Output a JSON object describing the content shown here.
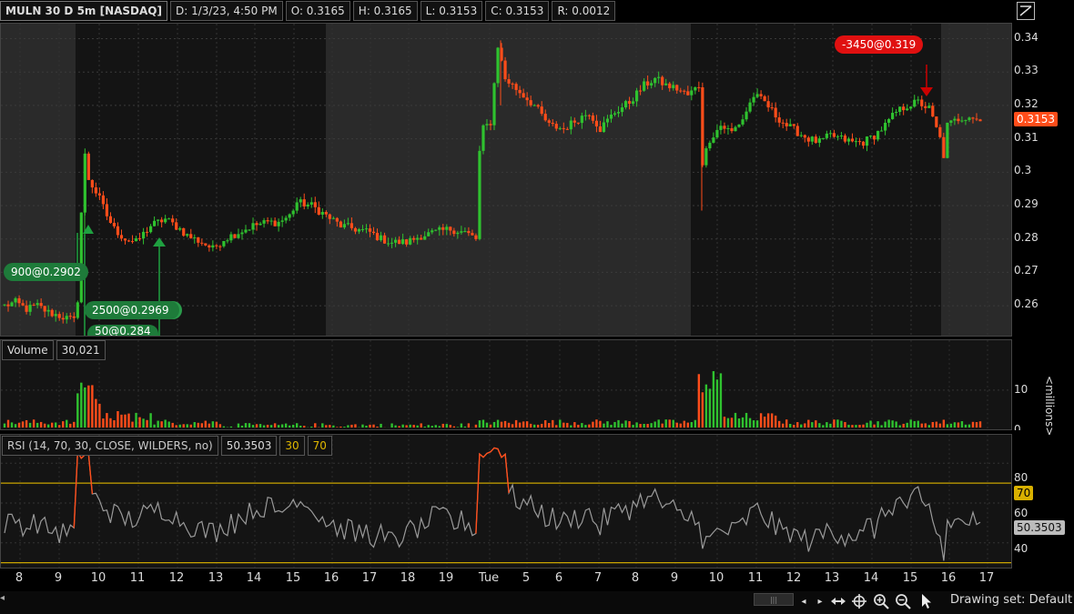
{
  "header": {
    "symbol": "MULN 30 D 5m [NASDAQ]",
    "date": "D: 1/3/23, 4:50 PM",
    "open": "O: 0.3165",
    "high": "H: 0.3165",
    "low": "L: 0.3153",
    "close": "C: 0.3153",
    "range": "R: 0.0012"
  },
  "price_axis": {
    "labels": [
      "0.34",
      "0.33",
      "0.32",
      "0.31",
      "0.3",
      "0.29",
      "0.28",
      "0.27",
      "0.26"
    ],
    "last_price": "0.3153"
  },
  "trades": {
    "sell": "-3450@0.319",
    "buy1": "900@0.2902",
    "buy2": "2500@0.2969",
    "buy3": "50@0.284"
  },
  "volume": {
    "label": "Volume",
    "value": "30,021",
    "axis_labels": [
      "10",
      "0"
    ],
    "unit": "<millions>"
  },
  "rsi": {
    "label": "RSI (14, 70, 30, CLOSE, WILDERS, no)",
    "value": "50.3503",
    "ob": "30",
    "os": "70",
    "axis_labels": [
      "80",
      "60",
      "40"
    ],
    "tag70": "70",
    "tagval": "50.3503"
  },
  "time_axis": {
    "labels": [
      "8",
      "9",
      "10",
      "11",
      "12",
      "13",
      "14",
      "15",
      "16",
      "17",
      "18",
      "19",
      "Tue",
      "5",
      "6",
      "7",
      "8",
      "9",
      "10",
      "11",
      "12",
      "13",
      "14",
      "15",
      "16",
      "17"
    ]
  },
  "footer": {
    "drawing_set": "Drawing set: Default"
  },
  "colors": {
    "up": "#2fc22f",
    "down": "#ff4d1a",
    "rsi_line": "#9a9a9a",
    "rsi_hot": "#ff4d1a",
    "band": "#c9a400",
    "sell_tag": "#e01010",
    "buy_tag": "#1e7b3a"
  },
  "chart_data": {
    "type": "candlestick",
    "price_range": [
      0.2505,
      0.3445
    ],
    "price_path": [
      [
        0,
        0.26
      ],
      [
        3,
        0.261
      ],
      [
        6,
        0.259
      ],
      [
        9,
        0.26
      ],
      [
        12,
        0.258
      ],
      [
        15,
        0.257
      ],
      [
        19,
        0.2555
      ],
      [
        20,
        0.262
      ],
      [
        21,
        0.288
      ],
      [
        22,
        0.305
      ],
      [
        23,
        0.298
      ],
      [
        24,
        0.296
      ],
      [
        26,
        0.292
      ],
      [
        28,
        0.287
      ],
      [
        30,
        0.283
      ],
      [
        33,
        0.28
      ],
      [
        36,
        0.279
      ],
      [
        40,
        0.284
      ],
      [
        44,
        0.286
      ],
      [
        48,
        0.283
      ],
      [
        50,
        0.281
      ],
      [
        54,
        0.279
      ],
      [
        57,
        0.277
      ],
      [
        60,
        0.28
      ],
      [
        64,
        0.282
      ],
      [
        68,
        0.284
      ],
      [
        72,
        0.285
      ],
      [
        75,
        0.285
      ],
      [
        78,
        0.287
      ],
      [
        80,
        0.291
      ],
      [
        84,
        0.29
      ],
      [
        88,
        0.287
      ],
      [
        92,
        0.284
      ],
      [
        96,
        0.283
      ],
      [
        100,
        0.282
      ],
      [
        103,
        0.28
      ],
      [
        106,
        0.279
      ],
      [
        110,
        0.279
      ],
      [
        114,
        0.281
      ],
      [
        118,
        0.282
      ],
      [
        122,
        0.283
      ],
      [
        126,
        0.282
      ],
      [
        129,
        0.28
      ],
      [
        130,
        0.306
      ],
      [
        131,
        0.313
      ],
      [
        133,
        0.315
      ],
      [
        135,
        0.338
      ],
      [
        137,
        0.328
      ],
      [
        141,
        0.324
      ],
      [
        145,
        0.32
      ],
      [
        149,
        0.314
      ],
      [
        153,
        0.313
      ],
      [
        157,
        0.316
      ],
      [
        160,
        0.318
      ],
      [
        163,
        0.313
      ],
      [
        167,
        0.318
      ],
      [
        171,
        0.321
      ],
      [
        175,
        0.326
      ],
      [
        178,
        0.328
      ],
      [
        181,
        0.326
      ],
      [
        184,
        0.325
      ],
      [
        187,
        0.323
      ],
      [
        190,
        0.326
      ],
      [
        191,
        0.303
      ],
      [
        193,
        0.31
      ],
      [
        196,
        0.314
      ],
      [
        199,
        0.312
      ],
      [
        202,
        0.316
      ],
      [
        205,
        0.323
      ],
      [
        208,
        0.321
      ],
      [
        211,
        0.317
      ],
      [
        214,
        0.314
      ],
      [
        217,
        0.312
      ],
      [
        220,
        0.31
      ],
      [
        223,
        0.309
      ],
      [
        226,
        0.311
      ],
      [
        229,
        0.31
      ],
      [
        232,
        0.309
      ],
      [
        235,
        0.309
      ],
      [
        238,
        0.311
      ],
      [
        241,
        0.314
      ],
      [
        244,
        0.318
      ],
      [
        247,
        0.32
      ],
      [
        250,
        0.321
      ],
      [
        253,
        0.319
      ],
      [
        256,
        0.31
      ],
      [
        257,
        0.305
      ],
      [
        258,
        0.314
      ],
      [
        261,
        0.316
      ],
      [
        264,
        0.317
      ],
      [
        267,
        0.3153
      ]
    ],
    "volume_max": 17,
    "rsi_ylim": [
      28,
      92
    ],
    "rsi_levels": [
      30,
      70
    ]
  }
}
